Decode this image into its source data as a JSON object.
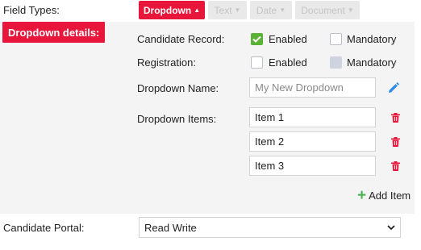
{
  "field_types": {
    "label": "Field Types:",
    "buttons": [
      {
        "label": "Dropdown",
        "state": "active"
      },
      {
        "label": "Text",
        "state": "disabled"
      },
      {
        "label": "Date",
        "state": "disabled"
      },
      {
        "label": "Document",
        "state": "disabled"
      }
    ]
  },
  "details": {
    "badge": "Dropdown details:",
    "candidate_record": {
      "label": "Candidate Record:",
      "enabled_label": "Enabled",
      "enabled_checked": true,
      "mandatory_label": "Mandatory",
      "mandatory_checked": false
    },
    "registration": {
      "label": "Registration:",
      "enabled_label": "Enabled",
      "enabled_checked": false,
      "mandatory_label": "Mandatory",
      "mandatory_checked": false,
      "mandatory_disabled": true
    },
    "dropdown_name": {
      "label": "Dropdown Name:",
      "placeholder": "My New Dropdown",
      "value": ""
    },
    "dropdown_items": {
      "label": "Dropdown Items:",
      "items": [
        "Item 1",
        "Item 2",
        "Item 3"
      ]
    },
    "add_item_label": "Add Item"
  },
  "candidate_portal": {
    "label": "Candidate Portal:",
    "selected": "Read Write"
  },
  "colors": {
    "accent": "#e8163a",
    "check_green": "#5ab235",
    "edit_blue": "#2f8be6",
    "add_green": "#4caf50"
  },
  "icons": [
    "caret-up-icon",
    "caret-down-icon",
    "check-icon",
    "pencil-icon",
    "trash-icon",
    "plus-icon",
    "chevron-down-icon"
  ]
}
